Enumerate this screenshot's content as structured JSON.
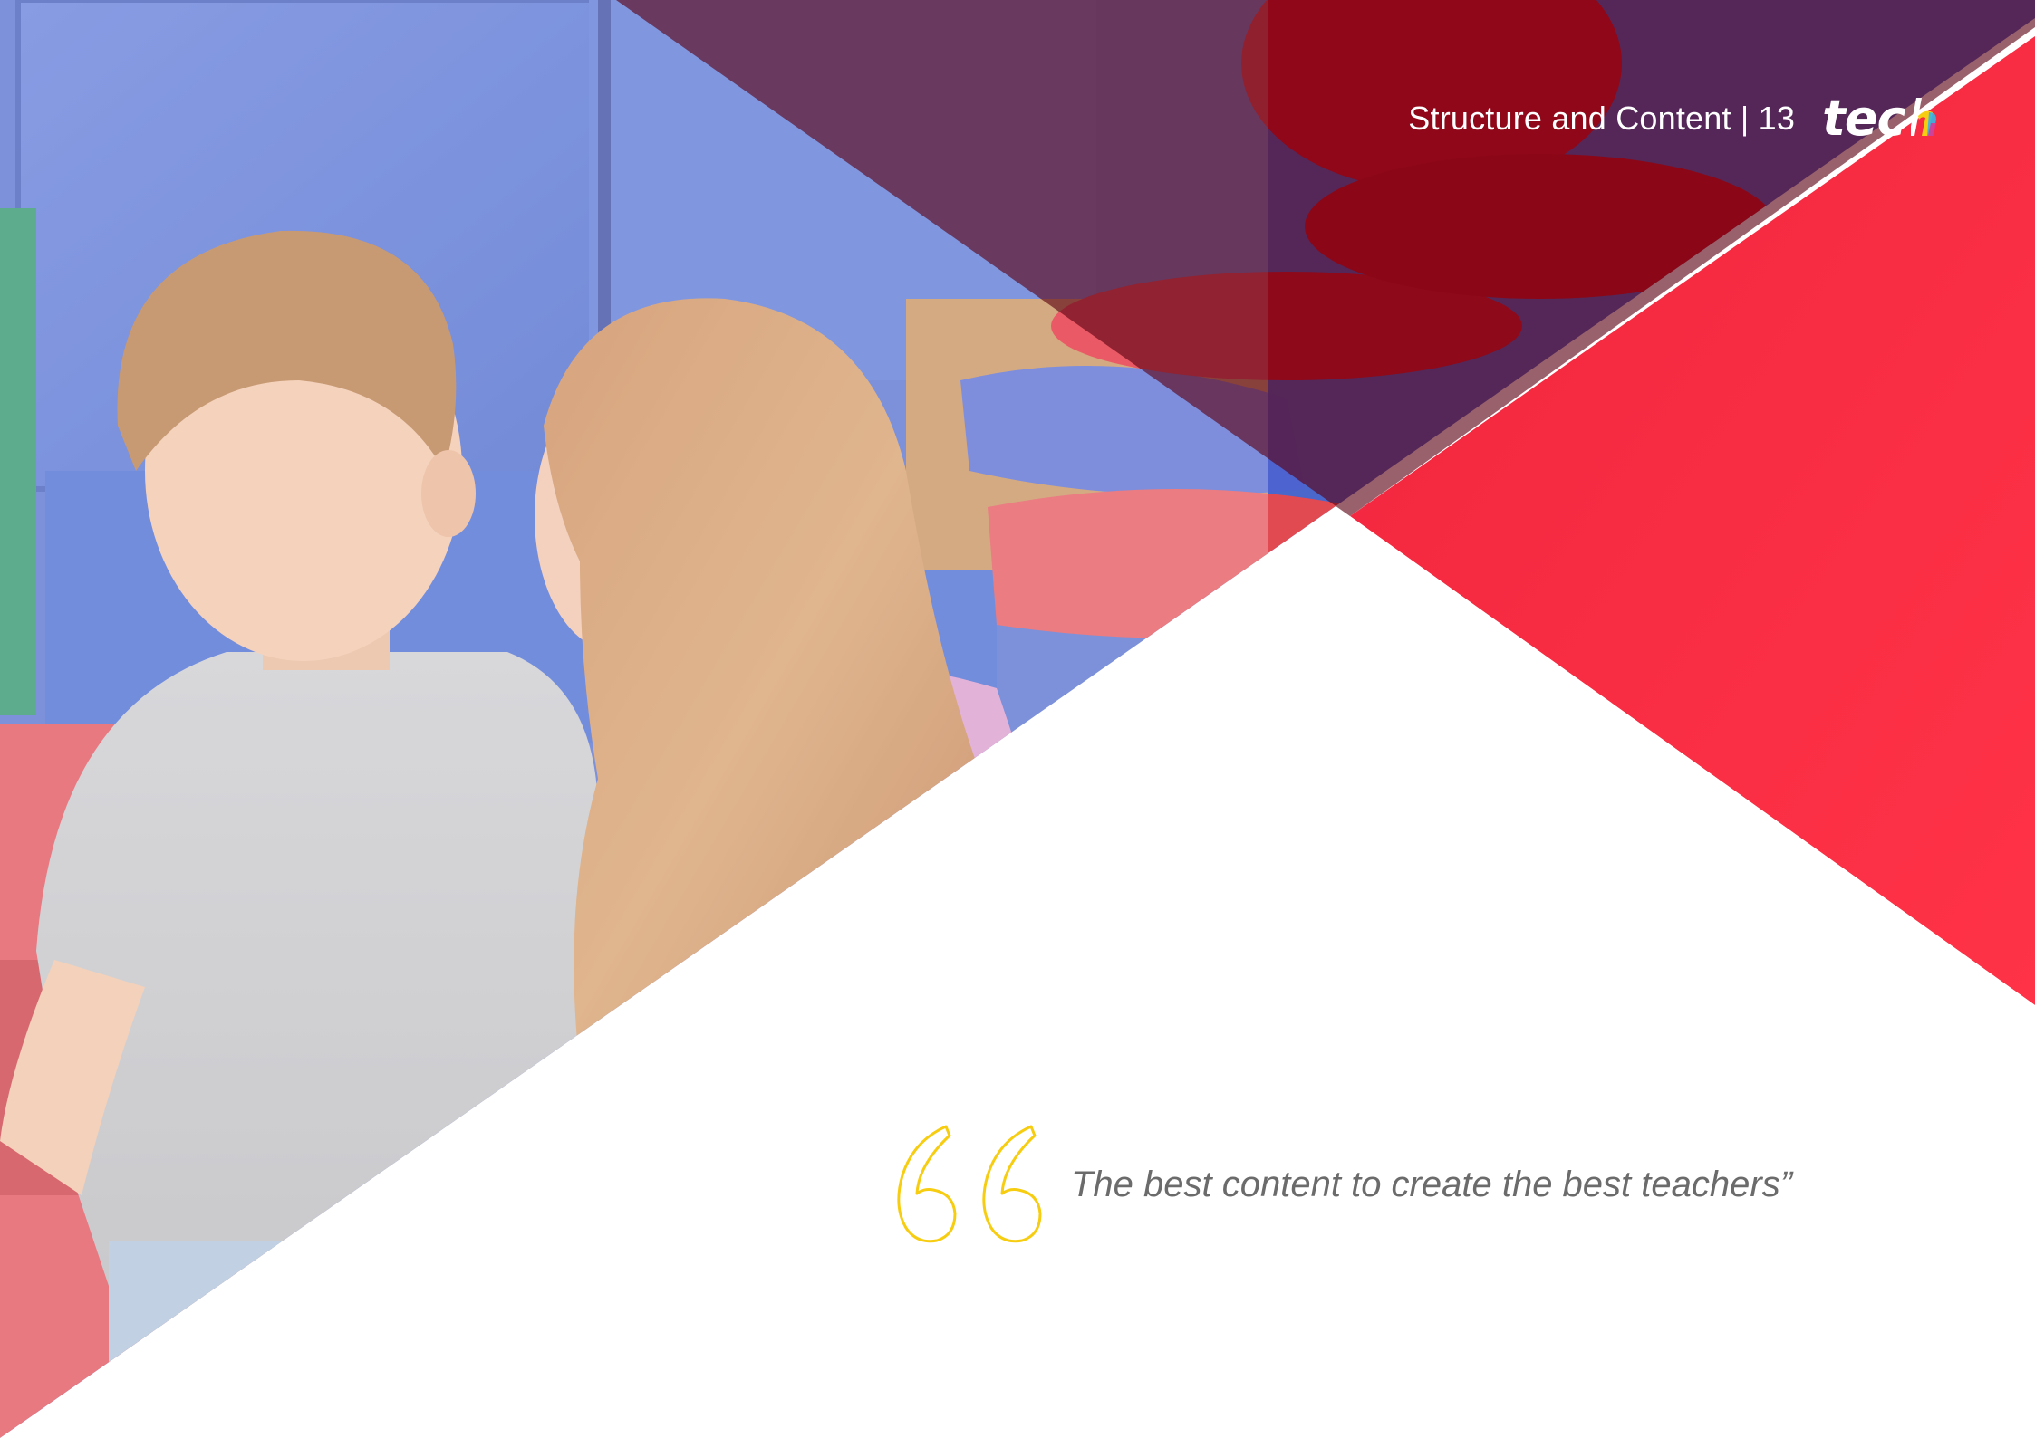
{
  "header": {
    "section_title": "Structure and Content | 13",
    "logo_text": "tec",
    "logo_last_letter": "h"
  },
  "quote": {
    "text": "The best content to create the best teachers”"
  },
  "colors": {
    "brand_red": "#f6213a",
    "dark_red": "#5a0010",
    "quote_mark_yellow": "#f7cd12",
    "quote_text_gray": "#6b6b6b"
  },
  "icons": {
    "quote_mark": "double-quote-outline-icon",
    "logo": "tech-logo-icon"
  }
}
